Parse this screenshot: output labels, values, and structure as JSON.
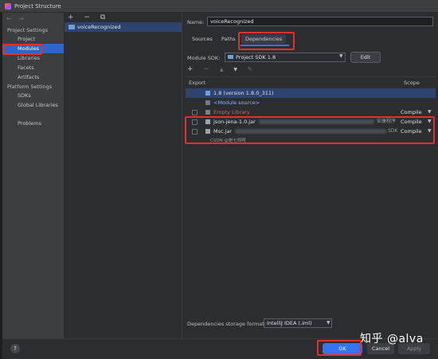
{
  "window": {
    "title": "Project Structure"
  },
  "sidebar": {
    "nav": {
      "back": "←",
      "forward": "→"
    },
    "project_settings_header": "Project Settings",
    "project_settings_items": [
      "Project",
      "Modules",
      "Libraries",
      "Facets",
      "Artifacts"
    ],
    "platform_settings_header": "Platform Settings",
    "platform_settings_items": [
      "SDKs",
      "Global Libraries"
    ],
    "problems": "Problems",
    "selected": "Modules"
  },
  "modules_panel": {
    "toolbar": {
      "add": "+",
      "remove": "−",
      "copy": "⧉"
    },
    "modules": [
      "voiceRecognized"
    ]
  },
  "module": {
    "name_label": "Name:",
    "name_value": "voiceRecognized",
    "tabs": [
      "Sources",
      "Paths",
      "Dependencies"
    ],
    "active_tab": "Dependencies",
    "module_sdk_label": "Module SDK:",
    "module_sdk_value": "Project SDK 1.8",
    "edit_button": "Edit"
  },
  "dependencies": {
    "toolbar": {
      "add": "+",
      "remove": "−",
      "up": "▲",
      "down": "▼",
      "edit": "✎"
    },
    "columns": {
      "export": "Export",
      "scope": "Scope"
    },
    "rows": [
      {
        "name": "1.8 (version 1.8.0_311)",
        "scope": "",
        "style": "normal",
        "checkbox": false,
        "selected": true
      },
      {
        "name": "<Module source>",
        "scope": "",
        "style": "blue",
        "checkbox": false,
        "selected": false
      },
      {
        "name": "Empty Library",
        "scope": "Compile",
        "style": "red",
        "checkbox": true,
        "selected": false
      },
      {
        "name": "json-jena-1.0.jar",
        "scope": "Compile",
        "style": "normal",
        "checkbox": true,
        "selected": false,
        "hint": "安康程序"
      },
      {
        "name": "Msc.jar",
        "scope": "Compile",
        "style": "normal",
        "checkbox": true,
        "selected": false,
        "hint": "SDK"
      }
    ],
    "storage_label": "Dependencies storage format:",
    "storage_value": "IntelliJ IDEA (.iml)"
  },
  "footer": {
    "help": "?",
    "ok": "OK",
    "cancel": "Cancel",
    "apply": "Apply"
  },
  "watermark": {
    "csdn": "CSDN @是七呀呀",
    "zhihu": "知乎 @alva"
  },
  "colors": {
    "accent": "#3574f0",
    "highlight": "#e0322b",
    "selection": "#2e436e"
  }
}
